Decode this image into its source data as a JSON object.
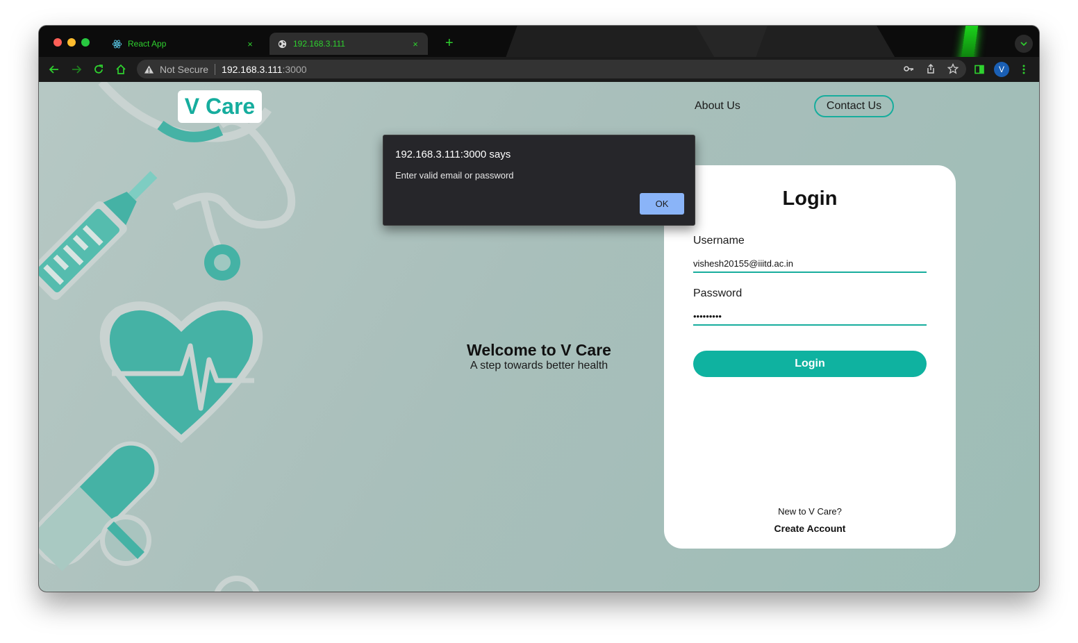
{
  "browser": {
    "tabs": [
      {
        "title": "React App",
        "close": "×"
      },
      {
        "title": "192.168.3.111",
        "close": "×"
      }
    ],
    "new_tab": "+",
    "address": {
      "security_label": "Not Secure",
      "host": "192.168.3.111",
      "port": ":3000"
    },
    "profile_initial": "V",
    "accent_color": "#2fd12f"
  },
  "site": {
    "logo": "V Care",
    "nav": {
      "about": "About Us",
      "contact": "Contact Us"
    },
    "welcome": {
      "title": "Welcome to V Care",
      "subtitle": "A step towards better health"
    },
    "brand_color": "#17ad9d"
  },
  "login": {
    "title": "Login",
    "username_label": "Username",
    "username_value": "vishesh20155@iiitd.ac.in",
    "password_label": "Password",
    "password_value": "•••••••••",
    "submit": "Login",
    "new_prompt": "New to V Care?",
    "create_account": "Create Account"
  },
  "alert": {
    "title": "192.168.3.111:3000 says",
    "message": "Enter valid email or password",
    "ok": "OK"
  }
}
